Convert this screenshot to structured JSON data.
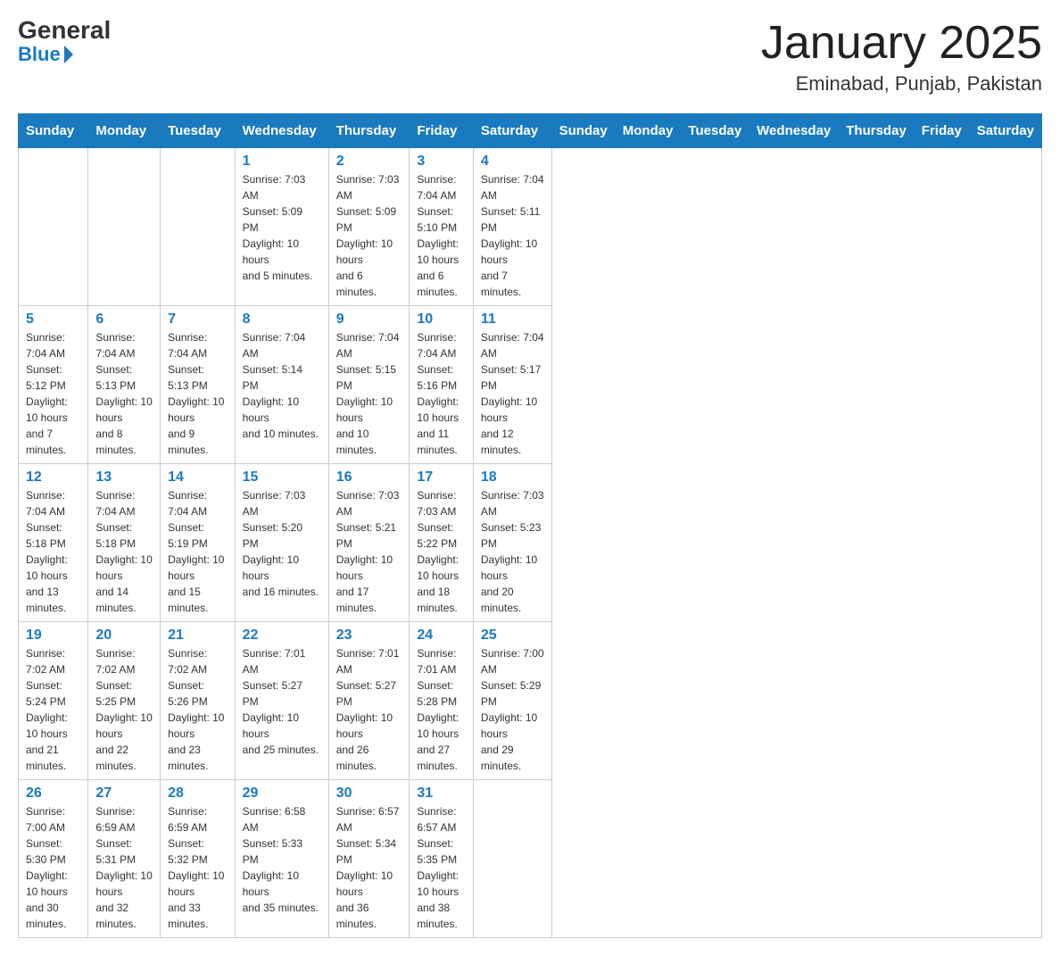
{
  "header": {
    "logo_general": "General",
    "logo_blue": "Blue",
    "month_title": "January 2025",
    "location": "Eminabad, Punjab, Pakistan"
  },
  "days_of_week": [
    "Sunday",
    "Monday",
    "Tuesday",
    "Wednesday",
    "Thursday",
    "Friday",
    "Saturday"
  ],
  "weeks": [
    [
      {
        "day": "",
        "info": ""
      },
      {
        "day": "",
        "info": ""
      },
      {
        "day": "",
        "info": ""
      },
      {
        "day": "1",
        "info": "Sunrise: 7:03 AM\nSunset: 5:09 PM\nDaylight: 10 hours\nand 5 minutes."
      },
      {
        "day": "2",
        "info": "Sunrise: 7:03 AM\nSunset: 5:09 PM\nDaylight: 10 hours\nand 6 minutes."
      },
      {
        "day": "3",
        "info": "Sunrise: 7:04 AM\nSunset: 5:10 PM\nDaylight: 10 hours\nand 6 minutes."
      },
      {
        "day": "4",
        "info": "Sunrise: 7:04 AM\nSunset: 5:11 PM\nDaylight: 10 hours\nand 7 minutes."
      }
    ],
    [
      {
        "day": "5",
        "info": "Sunrise: 7:04 AM\nSunset: 5:12 PM\nDaylight: 10 hours\nand 7 minutes."
      },
      {
        "day": "6",
        "info": "Sunrise: 7:04 AM\nSunset: 5:13 PM\nDaylight: 10 hours\nand 8 minutes."
      },
      {
        "day": "7",
        "info": "Sunrise: 7:04 AM\nSunset: 5:13 PM\nDaylight: 10 hours\nand 9 minutes."
      },
      {
        "day": "8",
        "info": "Sunrise: 7:04 AM\nSunset: 5:14 PM\nDaylight: 10 hours\nand 10 minutes."
      },
      {
        "day": "9",
        "info": "Sunrise: 7:04 AM\nSunset: 5:15 PM\nDaylight: 10 hours\nand 10 minutes."
      },
      {
        "day": "10",
        "info": "Sunrise: 7:04 AM\nSunset: 5:16 PM\nDaylight: 10 hours\nand 11 minutes."
      },
      {
        "day": "11",
        "info": "Sunrise: 7:04 AM\nSunset: 5:17 PM\nDaylight: 10 hours\nand 12 minutes."
      }
    ],
    [
      {
        "day": "12",
        "info": "Sunrise: 7:04 AM\nSunset: 5:18 PM\nDaylight: 10 hours\nand 13 minutes."
      },
      {
        "day": "13",
        "info": "Sunrise: 7:04 AM\nSunset: 5:18 PM\nDaylight: 10 hours\nand 14 minutes."
      },
      {
        "day": "14",
        "info": "Sunrise: 7:04 AM\nSunset: 5:19 PM\nDaylight: 10 hours\nand 15 minutes."
      },
      {
        "day": "15",
        "info": "Sunrise: 7:03 AM\nSunset: 5:20 PM\nDaylight: 10 hours\nand 16 minutes."
      },
      {
        "day": "16",
        "info": "Sunrise: 7:03 AM\nSunset: 5:21 PM\nDaylight: 10 hours\nand 17 minutes."
      },
      {
        "day": "17",
        "info": "Sunrise: 7:03 AM\nSunset: 5:22 PM\nDaylight: 10 hours\nand 18 minutes."
      },
      {
        "day": "18",
        "info": "Sunrise: 7:03 AM\nSunset: 5:23 PM\nDaylight: 10 hours\nand 20 minutes."
      }
    ],
    [
      {
        "day": "19",
        "info": "Sunrise: 7:02 AM\nSunset: 5:24 PM\nDaylight: 10 hours\nand 21 minutes."
      },
      {
        "day": "20",
        "info": "Sunrise: 7:02 AM\nSunset: 5:25 PM\nDaylight: 10 hours\nand 22 minutes."
      },
      {
        "day": "21",
        "info": "Sunrise: 7:02 AM\nSunset: 5:26 PM\nDaylight: 10 hours\nand 23 minutes."
      },
      {
        "day": "22",
        "info": "Sunrise: 7:01 AM\nSunset: 5:27 PM\nDaylight: 10 hours\nand 25 minutes."
      },
      {
        "day": "23",
        "info": "Sunrise: 7:01 AM\nSunset: 5:27 PM\nDaylight: 10 hours\nand 26 minutes."
      },
      {
        "day": "24",
        "info": "Sunrise: 7:01 AM\nSunset: 5:28 PM\nDaylight: 10 hours\nand 27 minutes."
      },
      {
        "day": "25",
        "info": "Sunrise: 7:00 AM\nSunset: 5:29 PM\nDaylight: 10 hours\nand 29 minutes."
      }
    ],
    [
      {
        "day": "26",
        "info": "Sunrise: 7:00 AM\nSunset: 5:30 PM\nDaylight: 10 hours\nand 30 minutes."
      },
      {
        "day": "27",
        "info": "Sunrise: 6:59 AM\nSunset: 5:31 PM\nDaylight: 10 hours\nand 32 minutes."
      },
      {
        "day": "28",
        "info": "Sunrise: 6:59 AM\nSunset: 5:32 PM\nDaylight: 10 hours\nand 33 minutes."
      },
      {
        "day": "29",
        "info": "Sunrise: 6:58 AM\nSunset: 5:33 PM\nDaylight: 10 hours\nand 35 minutes."
      },
      {
        "day": "30",
        "info": "Sunrise: 6:57 AM\nSunset: 5:34 PM\nDaylight: 10 hours\nand 36 minutes."
      },
      {
        "day": "31",
        "info": "Sunrise: 6:57 AM\nSunset: 5:35 PM\nDaylight: 10 hours\nand 38 minutes."
      },
      {
        "day": "",
        "info": ""
      }
    ]
  ]
}
